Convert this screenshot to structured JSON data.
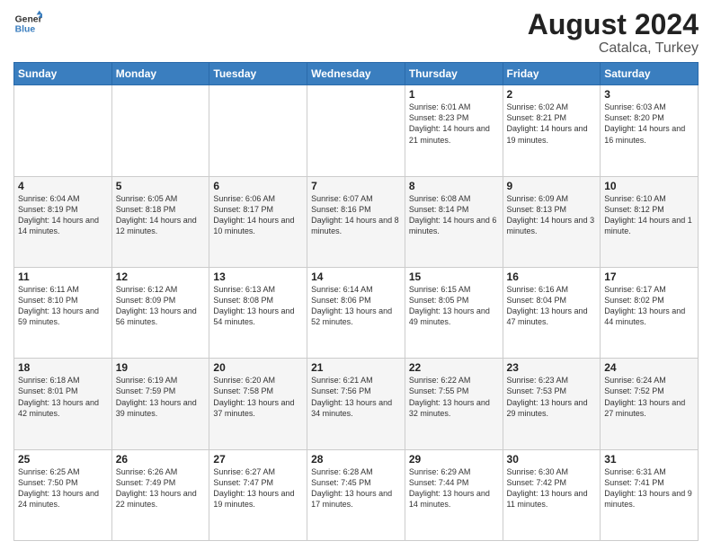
{
  "header": {
    "logo_line1": "General",
    "logo_line2": "Blue",
    "main_title": "August 2024",
    "subtitle": "Catalca, Turkey"
  },
  "days_of_week": [
    "Sunday",
    "Monday",
    "Tuesday",
    "Wednesday",
    "Thursday",
    "Friday",
    "Saturday"
  ],
  "weeks": [
    [
      {
        "day": "",
        "info": ""
      },
      {
        "day": "",
        "info": ""
      },
      {
        "day": "",
        "info": ""
      },
      {
        "day": "",
        "info": ""
      },
      {
        "day": "1",
        "info": "Sunrise: 6:01 AM\nSunset: 8:23 PM\nDaylight: 14 hours\nand 21 minutes."
      },
      {
        "day": "2",
        "info": "Sunrise: 6:02 AM\nSunset: 8:21 PM\nDaylight: 14 hours\nand 19 minutes."
      },
      {
        "day": "3",
        "info": "Sunrise: 6:03 AM\nSunset: 8:20 PM\nDaylight: 14 hours\nand 16 minutes."
      }
    ],
    [
      {
        "day": "4",
        "info": "Sunrise: 6:04 AM\nSunset: 8:19 PM\nDaylight: 14 hours\nand 14 minutes."
      },
      {
        "day": "5",
        "info": "Sunrise: 6:05 AM\nSunset: 8:18 PM\nDaylight: 14 hours\nand 12 minutes."
      },
      {
        "day": "6",
        "info": "Sunrise: 6:06 AM\nSunset: 8:17 PM\nDaylight: 14 hours\nand 10 minutes."
      },
      {
        "day": "7",
        "info": "Sunrise: 6:07 AM\nSunset: 8:16 PM\nDaylight: 14 hours\nand 8 minutes."
      },
      {
        "day": "8",
        "info": "Sunrise: 6:08 AM\nSunset: 8:14 PM\nDaylight: 14 hours\nand 6 minutes."
      },
      {
        "day": "9",
        "info": "Sunrise: 6:09 AM\nSunset: 8:13 PM\nDaylight: 14 hours\nand 3 minutes."
      },
      {
        "day": "10",
        "info": "Sunrise: 6:10 AM\nSunset: 8:12 PM\nDaylight: 14 hours\nand 1 minute."
      }
    ],
    [
      {
        "day": "11",
        "info": "Sunrise: 6:11 AM\nSunset: 8:10 PM\nDaylight: 13 hours\nand 59 minutes."
      },
      {
        "day": "12",
        "info": "Sunrise: 6:12 AM\nSunset: 8:09 PM\nDaylight: 13 hours\nand 56 minutes."
      },
      {
        "day": "13",
        "info": "Sunrise: 6:13 AM\nSunset: 8:08 PM\nDaylight: 13 hours\nand 54 minutes."
      },
      {
        "day": "14",
        "info": "Sunrise: 6:14 AM\nSunset: 8:06 PM\nDaylight: 13 hours\nand 52 minutes."
      },
      {
        "day": "15",
        "info": "Sunrise: 6:15 AM\nSunset: 8:05 PM\nDaylight: 13 hours\nand 49 minutes."
      },
      {
        "day": "16",
        "info": "Sunrise: 6:16 AM\nSunset: 8:04 PM\nDaylight: 13 hours\nand 47 minutes."
      },
      {
        "day": "17",
        "info": "Sunrise: 6:17 AM\nSunset: 8:02 PM\nDaylight: 13 hours\nand 44 minutes."
      }
    ],
    [
      {
        "day": "18",
        "info": "Sunrise: 6:18 AM\nSunset: 8:01 PM\nDaylight: 13 hours\nand 42 minutes."
      },
      {
        "day": "19",
        "info": "Sunrise: 6:19 AM\nSunset: 7:59 PM\nDaylight: 13 hours\nand 39 minutes."
      },
      {
        "day": "20",
        "info": "Sunrise: 6:20 AM\nSunset: 7:58 PM\nDaylight: 13 hours\nand 37 minutes."
      },
      {
        "day": "21",
        "info": "Sunrise: 6:21 AM\nSunset: 7:56 PM\nDaylight: 13 hours\nand 34 minutes."
      },
      {
        "day": "22",
        "info": "Sunrise: 6:22 AM\nSunset: 7:55 PM\nDaylight: 13 hours\nand 32 minutes."
      },
      {
        "day": "23",
        "info": "Sunrise: 6:23 AM\nSunset: 7:53 PM\nDaylight: 13 hours\nand 29 minutes."
      },
      {
        "day": "24",
        "info": "Sunrise: 6:24 AM\nSunset: 7:52 PM\nDaylight: 13 hours\nand 27 minutes."
      }
    ],
    [
      {
        "day": "25",
        "info": "Sunrise: 6:25 AM\nSunset: 7:50 PM\nDaylight: 13 hours\nand 24 minutes."
      },
      {
        "day": "26",
        "info": "Sunrise: 6:26 AM\nSunset: 7:49 PM\nDaylight: 13 hours\nand 22 minutes."
      },
      {
        "day": "27",
        "info": "Sunrise: 6:27 AM\nSunset: 7:47 PM\nDaylight: 13 hours\nand 19 minutes."
      },
      {
        "day": "28",
        "info": "Sunrise: 6:28 AM\nSunset: 7:45 PM\nDaylight: 13 hours\nand 17 minutes."
      },
      {
        "day": "29",
        "info": "Sunrise: 6:29 AM\nSunset: 7:44 PM\nDaylight: 13 hours\nand 14 minutes."
      },
      {
        "day": "30",
        "info": "Sunrise: 6:30 AM\nSunset: 7:42 PM\nDaylight: 13 hours\nand 11 minutes."
      },
      {
        "day": "31",
        "info": "Sunrise: 6:31 AM\nSunset: 7:41 PM\nDaylight: 13 hours\nand 9 minutes."
      }
    ]
  ]
}
